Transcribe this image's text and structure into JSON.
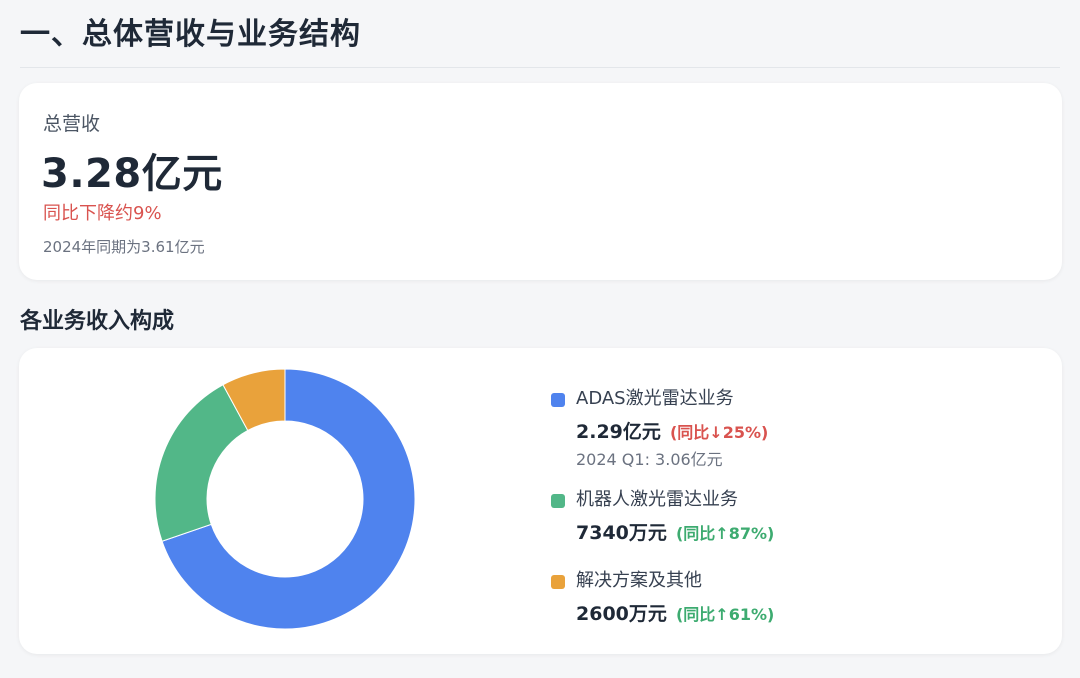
{
  "header": {
    "title": "一、总体营收与业务结构"
  },
  "total_card": {
    "label": "总营收",
    "value": "3.28亿元",
    "change": "同比下降约9%",
    "compare": "2024年同期为3.61亿元"
  },
  "composition": {
    "title": "各业务收入构成"
  },
  "colors": {
    "down": "#d9534f",
    "up": "#3dab70"
  },
  "chart_data": {
    "type": "pie",
    "donut": true,
    "unit": "万元",
    "series": [
      {
        "name": "ADAS激光雷达业务",
        "value": 22900,
        "value_label": "2.29亿元",
        "change_label": "(同比↓25%)",
        "direction": "down",
        "prev_label": "2024 Q1: 3.06亿元",
        "color": "#4f83ee"
      },
      {
        "name": "机器人激光雷达业务",
        "value": 7340,
        "value_label": "7340万元",
        "change_label": "(同比↑87%)",
        "direction": "up",
        "prev_label": "",
        "color": "#52b788"
      },
      {
        "name": "解决方案及其他",
        "value": 2600,
        "value_label": "2600万元",
        "change_label": "(同比↑61%)",
        "direction": "up",
        "prev_label": "",
        "color": "#e9a23b"
      }
    ]
  }
}
